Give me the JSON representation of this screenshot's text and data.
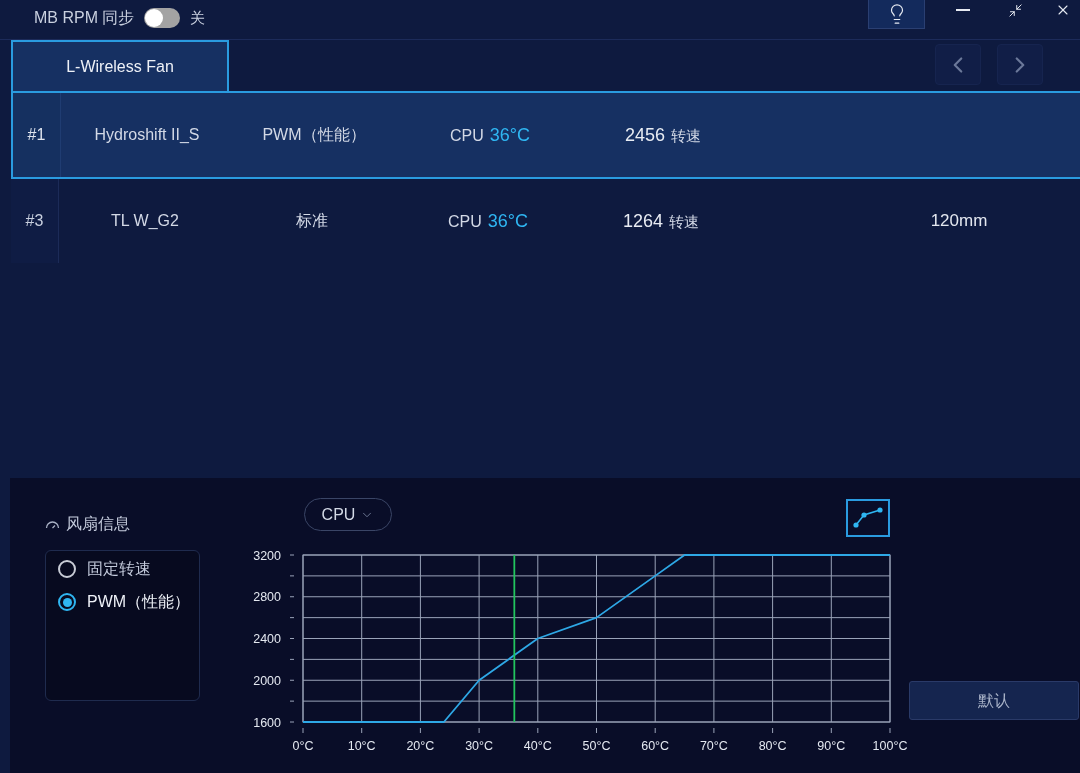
{
  "top_bar": {
    "sync_label": "MB RPM 同步",
    "sync_on": false,
    "sync_state": "关"
  },
  "tabs": [
    {
      "label": "L-Wireless Fan",
      "selected": true
    }
  ],
  "fans": [
    {
      "index": "#1",
      "name": "Hydroshift II_S",
      "mode": "PWM（性能）",
      "sensor": "CPU",
      "temperature": "36°C",
      "rpm": "2456",
      "rpm_unit": "转速",
      "selected": true
    },
    {
      "index": "#3",
      "name": "TL W_G2",
      "mode": "标准",
      "sensor": "CPU",
      "temperature": "36°C",
      "rpm": "1264",
      "rpm_unit": "转速",
      "size": "120mm",
      "selected": false
    }
  ],
  "fan_info": {
    "title": "风扇信息",
    "modes": [
      {
        "label": "固定转速",
        "selected": false
      },
      {
        "label": "PWM（性能）",
        "selected": true
      }
    ]
  },
  "curve": {
    "source": "CPU",
    "chart_data": [
      {
        "type": "line",
        "xlim": [
          0,
          100
        ],
        "ylim": [
          1600,
          3200
        ],
        "xticks": [
          {
            "value": 0,
            "label": "0°C"
          },
          {
            "value": 10,
            "label": "10°C"
          },
          {
            "value": 20,
            "label": "20°C"
          },
          {
            "value": 30,
            "label": "30°C"
          },
          {
            "value": 40,
            "label": "40°C"
          },
          {
            "value": 50,
            "label": "50°C"
          },
          {
            "value": 60,
            "label": "60°C"
          },
          {
            "value": 70,
            "label": "70°C"
          },
          {
            "value": 80,
            "label": "80°C"
          },
          {
            "value": 90,
            "label": "90°C"
          },
          {
            "value": 100,
            "label": "100°C"
          }
        ],
        "yticks": [
          1600,
          2000,
          2400,
          2800,
          3200
        ],
        "grid": true,
        "series": [
          {
            "color": "#2ea8e6",
            "x": [
              0,
              24,
              30,
              40,
              50,
              60,
              65,
              100
            ],
            "values": [
              1600,
              1600,
              2000,
              2400,
              2600,
              3000,
              3200,
              3200
            ]
          }
        ],
        "ref_lines": [
          {
            "axis": "x",
            "value": 36,
            "color": "#22c55e"
          }
        ]
      }
    ]
  },
  "default_button": "默认"
}
